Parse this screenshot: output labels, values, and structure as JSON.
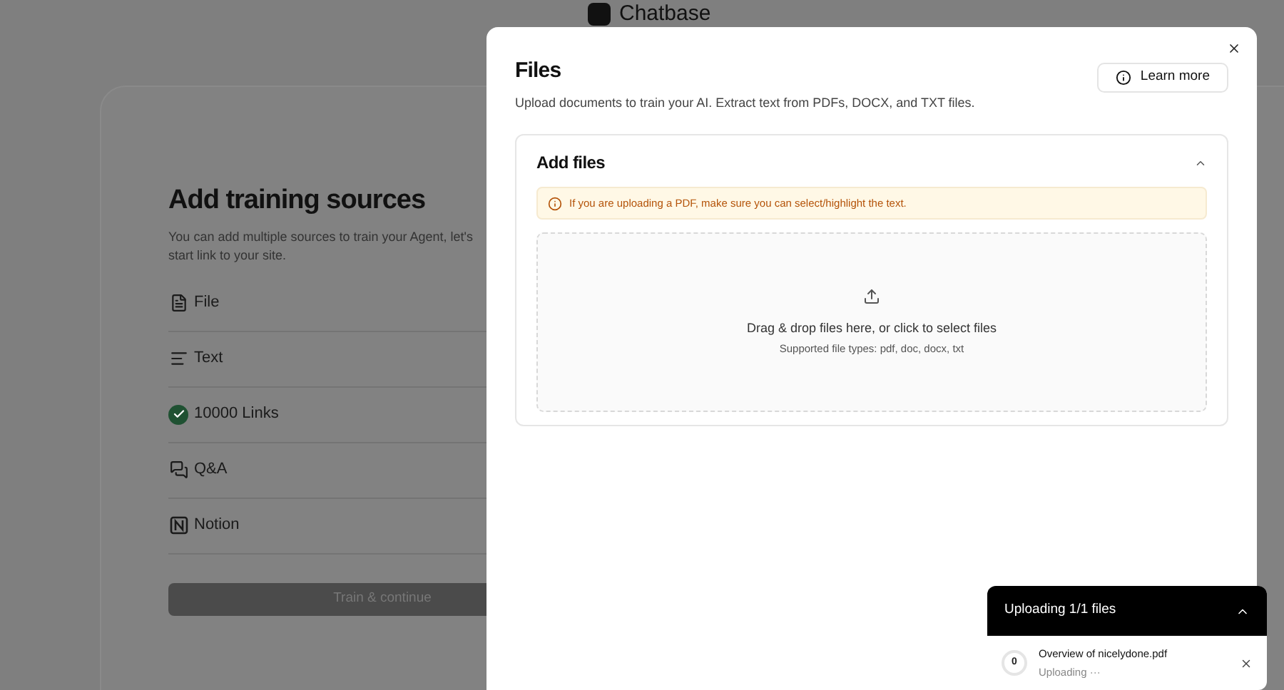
{
  "logo": {
    "text": "Chatbase"
  },
  "sources": {
    "title": "Add training sources",
    "description": "You can add multiple sources to train your Agent, let's start link to your site.",
    "items": [
      {
        "kind": "file",
        "label": "File",
        "checked": false
      },
      {
        "kind": "text",
        "label": "Text",
        "checked": false
      },
      {
        "label": "10000 Links",
        "checked": true
      },
      {
        "kind": "qa",
        "label": "Q&A",
        "checked": false
      },
      {
        "kind": "notion",
        "label": "Notion",
        "checked": false
      }
    ],
    "button": {
      "label": "Train & continue",
      "disabled": true
    }
  },
  "modal": {
    "title": "Files",
    "subtitle": "Upload documents to train your AI. Extract text from PDFs, DOCX, and TXT files.",
    "learn_more": "Learn more",
    "section": {
      "title": "Add files",
      "expanded": true,
      "warning": "If you are uploading a PDF, make sure you can select/highlight the text.",
      "dropzone": {
        "title": "Drag & drop files here, or click to select files",
        "hint": "Supported file types: pdf, doc, docx, txt"
      }
    }
  },
  "upload": {
    "title": "Uploading 1/1 files",
    "expanded": true,
    "files": [
      {
        "name": "Overview of nicelydone.pdf",
        "progress": "0",
        "status": "Uploading ···"
      }
    ]
  }
}
